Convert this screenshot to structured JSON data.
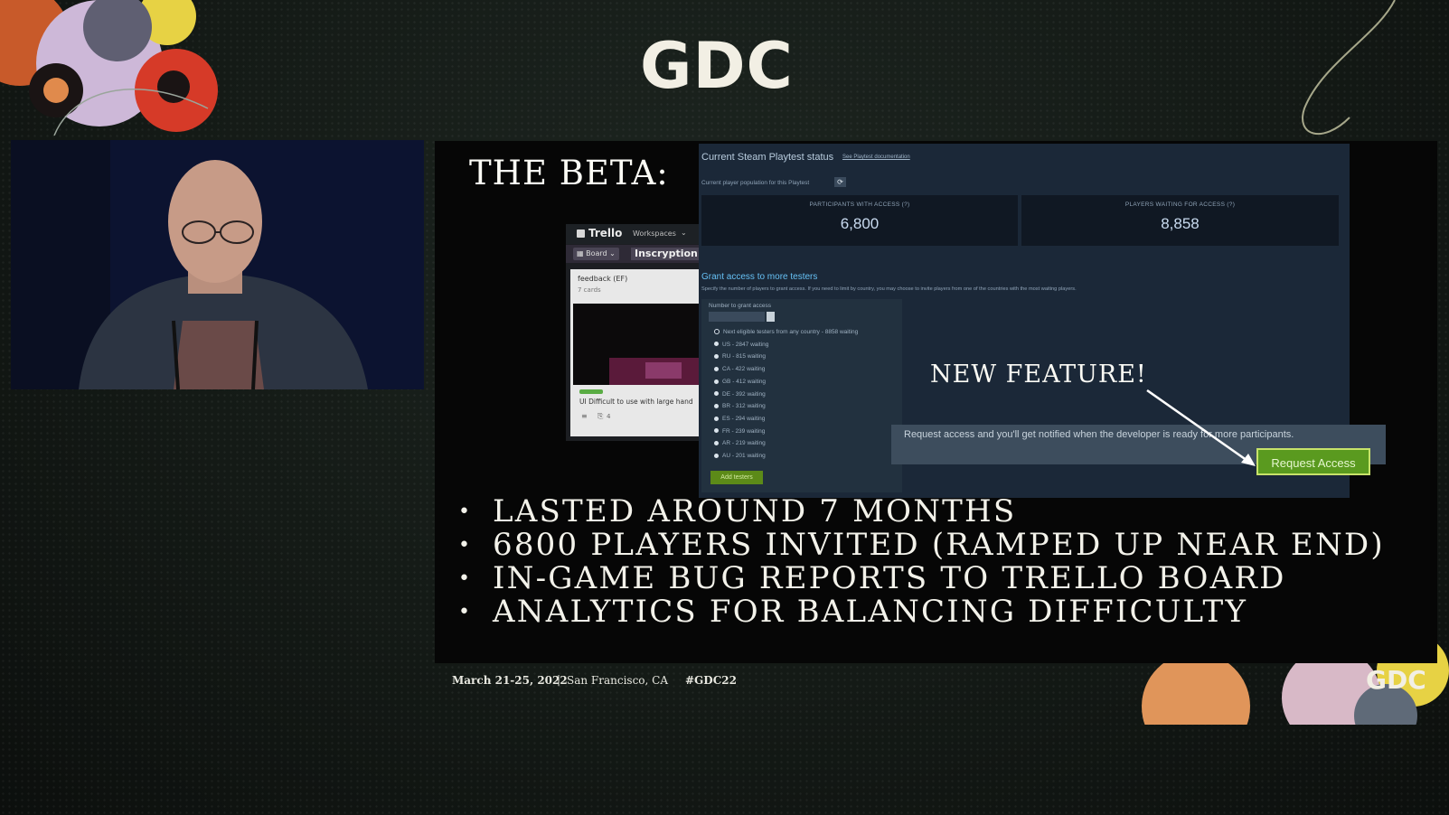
{
  "event_logo": "GDC",
  "slide": {
    "title": "THE BETA:",
    "callout": "NEW FEATURE!",
    "bullets": [
      "LASTED AROUND 7 MONTHS",
      "6800 PLAYERS INVITED (RAMPED UP NEAR END)",
      "IN-GAME BUG REPORTS TO TRELLO BOARD",
      "ANALYTICS FOR BALANCING DIFFICULTY"
    ],
    "bullet_glyph": "•"
  },
  "trello": {
    "app_name": "Trello",
    "workspaces_label": "Workspaces",
    "board_label": "Board",
    "board_name": "Inscryption",
    "list_title": "feedback (EF)",
    "list_count": "7 cards",
    "card_text": "UI Difficult to use with large hand",
    "card_attachments": "4"
  },
  "steam": {
    "status_title": "Current Steam Playtest status",
    "doc_link": "See Playtest documentation",
    "population_label": "Current player population for this Playtest",
    "participants_label": "PARTICIPANTS WITH ACCESS (?)",
    "participants_value": "6,800",
    "waiting_label": "PLAYERS WAITING FOR ACCESS (?)",
    "waiting_value": "8,858",
    "grant_title": "Grant access to more testers",
    "grant_desc": "Specify the number of players to grant access. If you need to limit by country, you may choose to invite players from one of the countries with the most waiting players.",
    "number_label": "Number to grant access",
    "countries": [
      "Next eligible testers from any country - 8858 waiting",
      "US - 2847 waiting",
      "RU - 815 waiting",
      "CA - 422 waiting",
      "GB - 412 waiting",
      "DE - 392 waiting",
      "BR - 312 waiting",
      "ES - 294 waiting",
      "FR - 239 waiting",
      "AR - 219 waiting",
      "AU - 201 waiting"
    ],
    "add_testers_label": "Add testers",
    "request_text": "Request access and you'll get notified when the developer is ready for more participants.",
    "request_button": "Request Access"
  },
  "footer": {
    "dates": "March 21-25, 2022",
    "separator": "|",
    "location": "San Francisco, CA",
    "hashtag": "#GDC22",
    "logo": "GDC"
  },
  "colors": {
    "background": "#141a16",
    "slide_bg": "#060606",
    "steam_bg": "#1b2838",
    "steam_stat_value": "#c9dbf0",
    "request_button": "#5a9a1f",
    "add_testers": "#5c8a18",
    "gdc_logo": "#f2efe4"
  }
}
